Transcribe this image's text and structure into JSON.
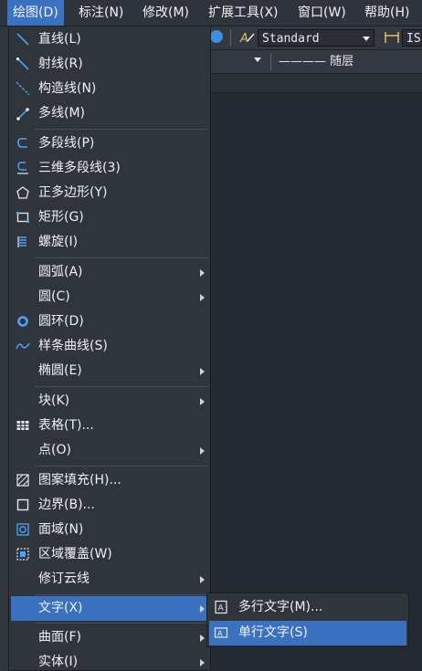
{
  "menubar": {
    "items": [
      {
        "label": "绘图(D)"
      },
      {
        "label": "标注(N)"
      },
      {
        "label": "修改(M)"
      },
      {
        "label": "扩展工具(X)"
      },
      {
        "label": "窗口(W)"
      },
      {
        "label": "帮助(H)"
      }
    ]
  },
  "toolbar": {
    "text_style_value": "Standard",
    "dim_style_value": "IS",
    "layer_value": "———— 随层"
  },
  "draw_menu": {
    "items": [
      {
        "label": "直线(L)",
        "icon": "line-icon"
      },
      {
        "label": "射线(R)",
        "icon": "ray-icon"
      },
      {
        "label": "构造线(N)",
        "icon": "construction-line-icon"
      },
      {
        "label": "多线(M)",
        "icon": "multiline-icon"
      },
      {
        "label": "多段线(P)",
        "icon": "polyline-icon"
      },
      {
        "label": "三维多段线(3)",
        "icon": "3d-polyline-icon"
      },
      {
        "label": "正多边形(Y)",
        "icon": "polygon-icon"
      },
      {
        "label": "矩形(G)",
        "icon": "rectangle-icon"
      },
      {
        "label": "螺旋(I)",
        "icon": "helix-icon"
      },
      {
        "label": "圆弧(A)",
        "icon": ""
      },
      {
        "label": "圆(C)",
        "icon": ""
      },
      {
        "label": "圆环(D)",
        "icon": "donut-icon"
      },
      {
        "label": "样条曲线(S)",
        "icon": "spline-icon"
      },
      {
        "label": "椭圆(E)",
        "icon": ""
      },
      {
        "label": "块(K)",
        "icon": ""
      },
      {
        "label": "表格(T)...",
        "icon": "table-icon"
      },
      {
        "label": "点(O)",
        "icon": ""
      },
      {
        "label": "图案填充(H)...",
        "icon": "hatch-icon"
      },
      {
        "label": "边界(B)...",
        "icon": "boundary-icon"
      },
      {
        "label": "面域(N)",
        "icon": "region-icon"
      },
      {
        "label": "区域覆盖(W)",
        "icon": "wipeout-icon"
      },
      {
        "label": "修订云线",
        "icon": ""
      },
      {
        "label": "文字(X)",
        "icon": ""
      },
      {
        "label": "曲面(F)",
        "icon": ""
      },
      {
        "label": "实体(I)",
        "icon": ""
      }
    ]
  },
  "text_submenu": {
    "items": [
      {
        "label": "多行文字(M)...",
        "icon": "mtext-icon"
      },
      {
        "label": "单行文字(S)",
        "icon": "single-line-text-icon"
      }
    ]
  },
  "colors": {
    "highlight": "#3b72bf",
    "menu_bg": "#30343b",
    "background": "#23262d"
  }
}
